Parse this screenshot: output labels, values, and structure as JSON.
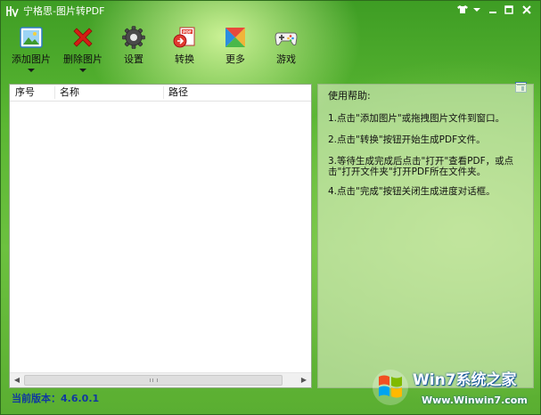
{
  "window": {
    "title": "宁格思-图片转PDF"
  },
  "titlebar_icons": [
    "shirt-skin-icon",
    "menu-arrow-icon",
    "minimize-icon",
    "maximize-icon",
    "close-icon"
  ],
  "toolbar": {
    "add_image": "添加图片",
    "delete_image": "删除图片",
    "settings": "设置",
    "convert": "转换",
    "more": "更多",
    "games": "游戏"
  },
  "list": {
    "columns": [
      "序号",
      "名称",
      "路径"
    ]
  },
  "help": {
    "title": "使用帮助:",
    "steps": [
      "1.点击\"添加图片\"或拖拽图片文件到窗口。",
      "2.点击\"转换\"按钮开始生成PDF文件。",
      "3.等待生成完成后点击\"打开\"查看PDF，或点\n击\"打开文件夹\"打开PDF所在文件夹。",
      "4.点击\"完成\"按钮关闭生成进度对话框。"
    ]
  },
  "status": {
    "version": "当前版本：4.6.0.1"
  },
  "watermark": {
    "brand": "Win7系统之家",
    "url": "Www.Winwin7.com"
  },
  "colors": {
    "window_green": "#5bb733",
    "help_panel": "#dceec4",
    "status_text": "#1038a0",
    "delete_red": "#d51d14"
  }
}
